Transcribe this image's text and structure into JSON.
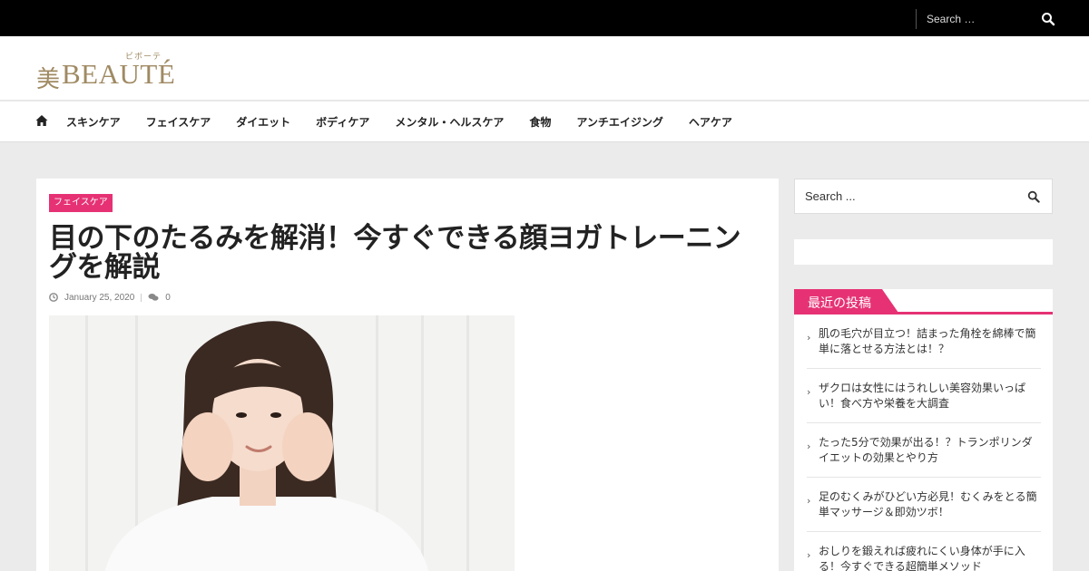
{
  "topbar": {
    "search_placeholder": "Search …"
  },
  "logo": {
    "kanji": "美",
    "word": "BEAUTÉ",
    "ruby": "ビボーテ"
  },
  "nav": {
    "items": [
      "スキンケア",
      "フェイスケア",
      "ダイエット",
      "ボディケア",
      "メンタル・ヘルスケア",
      "食物",
      "アンチエイジング",
      "ヘアケア"
    ]
  },
  "article": {
    "category": "フェイスケア",
    "title": "目の下のたるみを解消！今すぐできる顔ヨガトレーニングを解説",
    "date": "January 25, 2020",
    "comments": "0"
  },
  "sidebar": {
    "search_placeholder": "Search ...",
    "recent_title": "最近の投稿",
    "recent_posts": [
      "肌の毛穴が目立つ！詰まった角栓を綿棒で簡単に落とせる方法とは！？",
      "ザクロは女性にはうれしい美容効果いっぱい！食べ方や栄養を大調査",
      "たった5分で効果が出る！？トランポリンダイエットの効果とやり方",
      "足のむくみがひどい方必見！むくみをとる簡単マッサージ＆即効ツボ！",
      "おしりを鍛えれば疲れにくい身体が手に入る！今すぐできる超簡単メソッド"
    ]
  },
  "colors": {
    "accent": "#e63274",
    "logo": "#a08a63",
    "topbar": "#000000"
  }
}
